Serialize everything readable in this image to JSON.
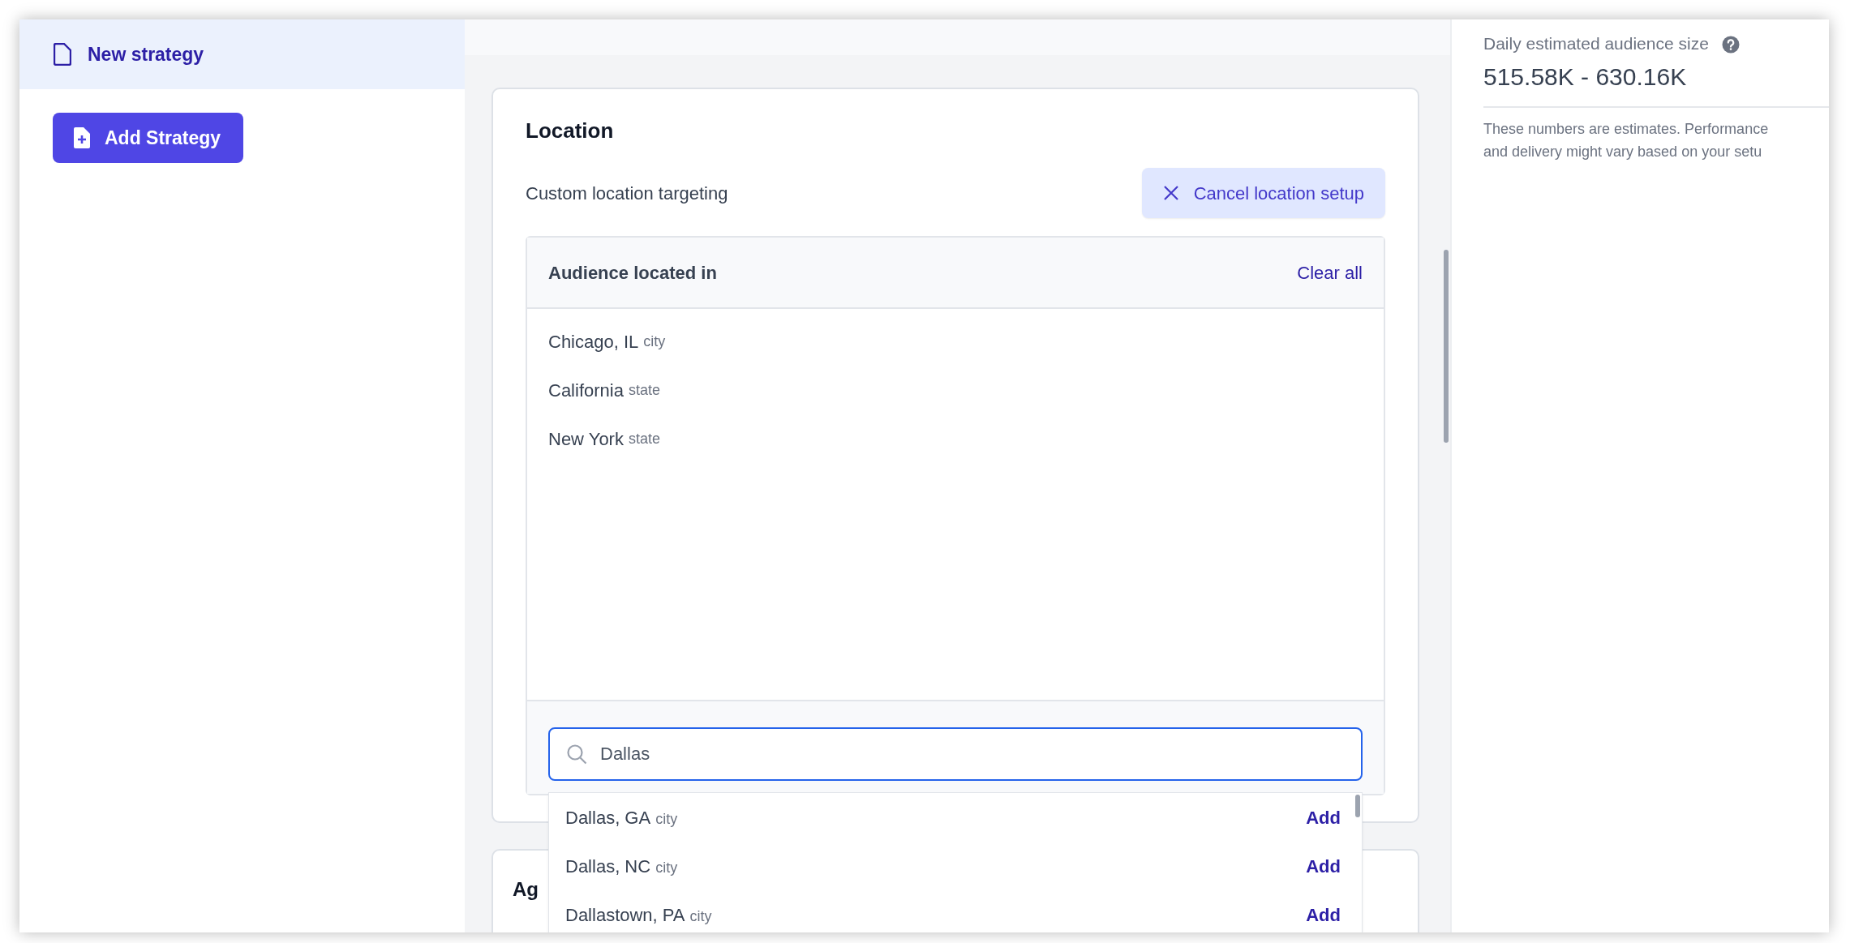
{
  "sidebar": {
    "items": [
      {
        "label": "New strategy",
        "selected": true
      }
    ],
    "add_button": "Add Strategy"
  },
  "location": {
    "title": "Location",
    "subtitle": "Custom location targeting",
    "cancel_button": "Cancel location setup",
    "audience": {
      "header": "Audience located in",
      "clear_all": "Clear all",
      "items": [
        {
          "name": "Chicago, IL",
          "type": "city"
        },
        {
          "name": "California",
          "type": "state"
        },
        {
          "name": "New York",
          "type": "state"
        }
      ]
    },
    "search": {
      "value": "Dallas"
    },
    "suggestions": [
      {
        "name": "Dallas, GA",
        "type": "city",
        "action": "Add"
      },
      {
        "name": "Dallas, NC",
        "type": "city",
        "action": "Add"
      },
      {
        "name": "Dallastown, PA",
        "type": "city",
        "action": "Add"
      }
    ]
  },
  "next_section": {
    "title": "Ag"
  },
  "estimate": {
    "label": "Daily estimated audience size",
    "value": "515.58K - 630.16K",
    "note": "These numbers are estimates. Performance\nand delivery might vary based on your setu"
  }
}
